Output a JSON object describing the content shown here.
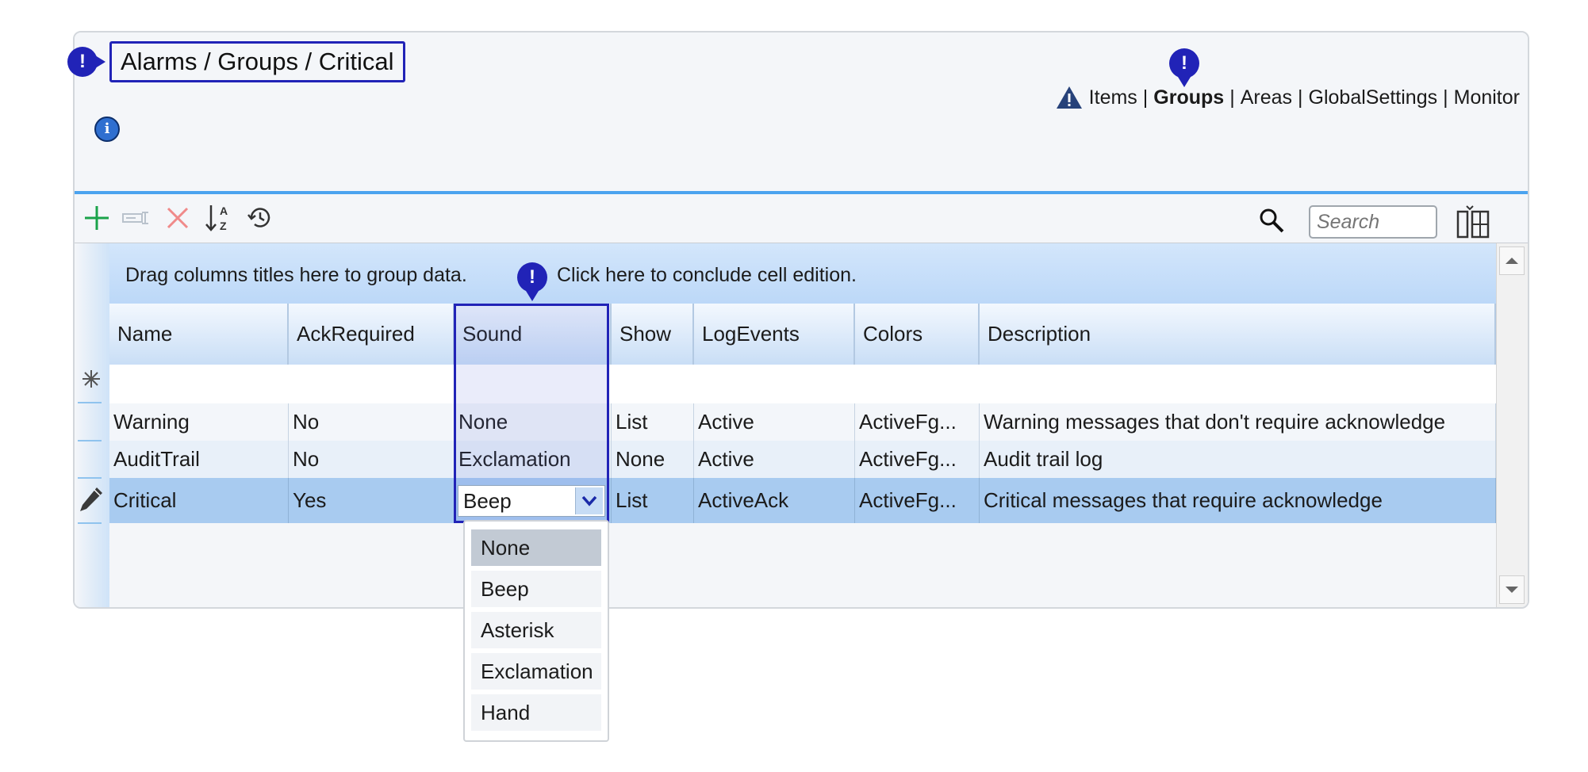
{
  "breadcrumb": "Alarms / Groups / Critical",
  "nav": {
    "items": "Items",
    "groups": "Groups",
    "areas": "Areas",
    "global_settings": "GlobalSettings",
    "monitor": "Monitor",
    "separator": "|",
    "active": "Groups"
  },
  "markers": {
    "symbol": "!"
  },
  "info_icon": "i",
  "toolbar": {
    "icons": [
      "add-icon",
      "rename-icon",
      "delete-icon",
      "sort-az-icon",
      "history-icon"
    ],
    "search_placeholder": "Search"
  },
  "grid": {
    "group_bar_text": "Drag columns titles here to group data.",
    "conclude_text": "Click here to conclude cell edition.",
    "columns": [
      "Name",
      "AckRequired",
      "Sound",
      "Show",
      "LogEvents",
      "Colors",
      "Description"
    ],
    "rows": [
      [
        "Warning",
        "No",
        "None",
        "List",
        "Active",
        "ActiveFg...",
        "Warning messages that don't require acknowledge"
      ],
      [
        "AuditTrail",
        "No",
        "Exclamation",
        "None",
        "Active",
        "ActiveFg...",
        "Audit trail log"
      ],
      [
        "Critical",
        "Yes",
        "Beep",
        "List",
        "ActiveAck",
        "ActiveFg...",
        "Critical messages that require acknowledge"
      ]
    ],
    "editing_row": 2,
    "editing_column": "Sound",
    "combo_value": "Beep"
  },
  "dropdown": {
    "options": [
      "None",
      "Beep",
      "Asterisk",
      "Exclamation",
      "Hand"
    ],
    "highlighted": "None"
  },
  "colors": {
    "accent": "#2123b7",
    "toolbar_line": "#4ba3ef",
    "selected_row": "#a8cbf0",
    "add_green": "#1aa34a",
    "delete_red": "#f08a8a"
  }
}
